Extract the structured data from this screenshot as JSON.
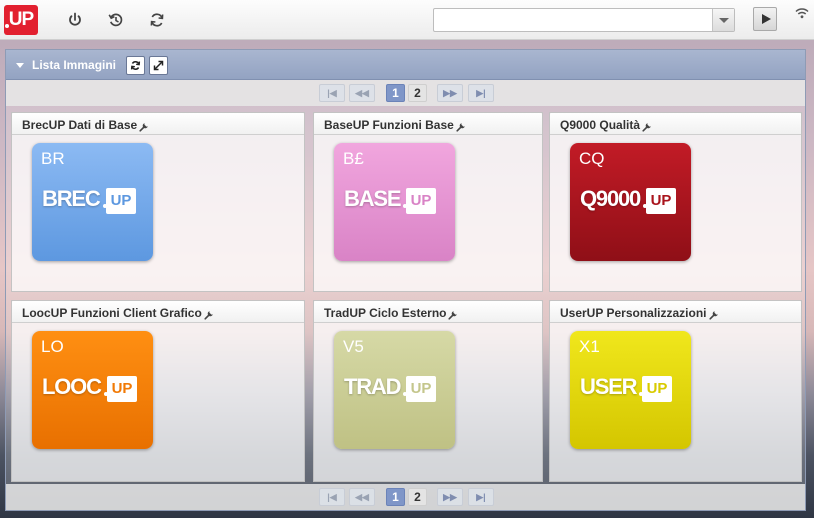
{
  "topbar": {
    "logo_text": "UP",
    "icons": [
      "power-icon",
      "history-icon",
      "refresh-icon",
      "wifi-icon"
    ],
    "combo_value": "",
    "combo_placeholder": ""
  },
  "panel": {
    "title": "Lista Immagini",
    "pagination": {
      "first": "|◀",
      "prev": "◀◀",
      "pages": [
        "1",
        "2"
      ],
      "current": "1",
      "next": "▶▶",
      "last": "▶|"
    }
  },
  "cards": [
    {
      "title": "BrecUP Dati di Base",
      "code": "BR",
      "name": "BREC",
      "color_top": "#8cbaf3",
      "color_bottom": "#5d98e0",
      "badge_color": "#5d98e0"
    },
    {
      "title": "BaseUP Funzioni Base",
      "code": "B£",
      "name": "BASE",
      "color_top": "#f1a6de",
      "color_bottom": "#d983c6",
      "badge_color": "#d983c6"
    },
    {
      "title": "Q9000 Qualità",
      "code": "CQ",
      "name": "Q9000",
      "color_top": "#c21b26",
      "color_bottom": "#8f0f17",
      "badge_color": "#a9141d"
    },
    {
      "title": "LoocUP Funzioni Client Grafico",
      "code": "LO",
      "name": "LOOC",
      "color_top": "#ff8f12",
      "color_bottom": "#e87000",
      "badge_color": "#f17a06"
    },
    {
      "title": "TradUP Ciclo Esterno",
      "code": "V5",
      "name": "TRAD",
      "color_top": "#d6d9a6",
      "color_bottom": "#bfc184",
      "badge_color": "#c4c68c"
    },
    {
      "title": "UserUP Personalizzazioni",
      "code": "X1",
      "name": "USER",
      "color_top": "#f0e71c",
      "color_bottom": "#d4c600",
      "badge_color": "#d9cb00"
    }
  ],
  "tile_badge_text": "UP"
}
